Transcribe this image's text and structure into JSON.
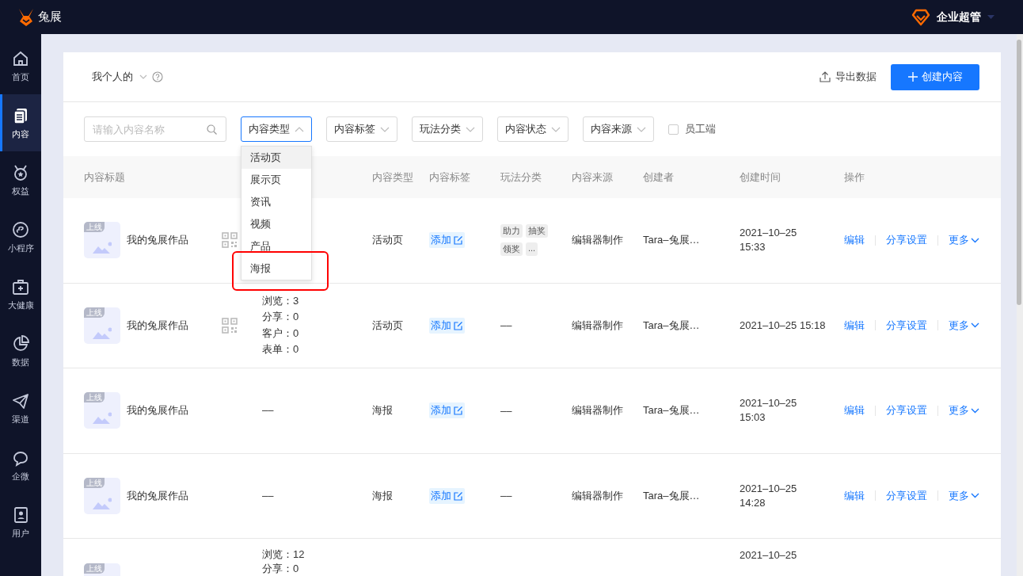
{
  "topbar": {
    "logo_text": "兔展",
    "account": "企业超管"
  },
  "sidebar": {
    "items": [
      {
        "label": "首页",
        "selected": false
      },
      {
        "label": "内容",
        "selected": true
      },
      {
        "label": "权益",
        "selected": false
      },
      {
        "label": "小程序",
        "selected": false
      },
      {
        "label": "大健康",
        "selected": false
      },
      {
        "label": "数据",
        "selected": false
      },
      {
        "label": "渠道",
        "selected": false
      },
      {
        "label": "企微",
        "selected": false
      },
      {
        "label": "用户",
        "selected": false
      }
    ]
  },
  "header": {
    "scope": "我个人的",
    "export": "导出数据",
    "create": "创建内容"
  },
  "filters": {
    "search_placeholder": "请输入内容名称",
    "selects": [
      {
        "label": "内容类型",
        "expanded": true
      },
      {
        "label": "内容标签",
        "expanded": false
      },
      {
        "label": "玩法分类",
        "expanded": false
      },
      {
        "label": "内容状态",
        "expanded": false
      },
      {
        "label": "内容来源",
        "expanded": false
      }
    ],
    "checkbox": {
      "label": "员工端",
      "checked": false
    }
  },
  "dropdown": {
    "options": [
      {
        "label": "活动页",
        "hovered": true,
        "highlighted": false
      },
      {
        "label": "展示页",
        "hovered": false,
        "highlighted": false
      },
      {
        "label": "资讯",
        "hovered": false,
        "highlighted": false
      },
      {
        "label": "视频",
        "hovered": false,
        "highlighted": false
      },
      {
        "label": "产品",
        "hovered": false,
        "highlighted": false
      },
      {
        "label": "海报",
        "hovered": false,
        "highlighted": true
      }
    ]
  },
  "table": {
    "columns": [
      "内容标题",
      "内容类型",
      "内容标签",
      "玩法分类",
      "内容来源",
      "创建者",
      "创建时间",
      "操作"
    ],
    "rows": [
      {
        "badge": "上线",
        "title": "我的兔展作品",
        "qr": true,
        "stats": [],
        "type": "活动页",
        "tag_action": "添加",
        "categories": [
          "助力",
          "抽奖",
          "领奖",
          "..."
        ],
        "source": "编辑器制作",
        "creator": "Tara–兔展…",
        "time": [
          "2021–10–25",
          "15:33"
        ],
        "actions": [
          "编辑",
          "分享设置",
          "更多"
        ]
      },
      {
        "badge": "上线",
        "title": "我的兔展作品",
        "qr": true,
        "stats": [
          "浏览：3",
          "分享：0",
          "客户：0",
          "表单：0"
        ],
        "type": "活动页",
        "tag_action": "添加",
        "categories": [
          "––"
        ],
        "source": "编辑器制作",
        "creator": "Tara–兔展…",
        "time": [
          "2021–10–25 15:18"
        ],
        "actions": [
          "编辑",
          "分享设置",
          "更多"
        ]
      },
      {
        "badge": "上线",
        "title": "我的兔展作品",
        "qr": false,
        "stats": [
          "––"
        ],
        "type": "海报",
        "tag_action": "添加",
        "categories": [
          "––"
        ],
        "source": "编辑器制作",
        "creator": "Tara–兔展…",
        "time": [
          "2021–10–25",
          "15:03"
        ],
        "actions": [
          "编辑",
          "分享设置",
          "更多"
        ]
      },
      {
        "badge": "上线",
        "title": "我的兔展作品",
        "qr": false,
        "stats": [
          "––"
        ],
        "type": "海报",
        "tag_action": "添加",
        "categories": [
          "––"
        ],
        "source": "编辑器制作",
        "creator": "Tara–兔展…",
        "time": [
          "2021–10–25",
          "14:28"
        ],
        "actions": [
          "编辑",
          "分享设置",
          "更多"
        ]
      },
      {
        "badge": "上线",
        "qr": false,
        "stats": [
          "浏览：12",
          "分享：0"
        ],
        "time": [
          "2021–10–25"
        ]
      }
    ]
  }
}
